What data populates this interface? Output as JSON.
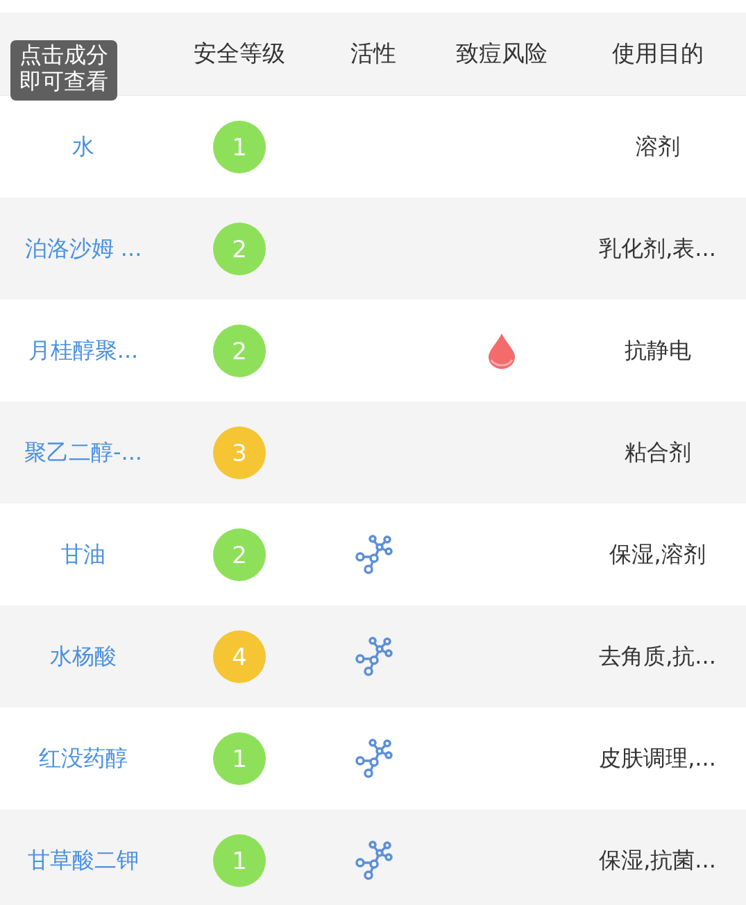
{
  "tooltip": "点击成分即可查看",
  "columns": [
    {
      "label": "安全等级"
    },
    {
      "label": "活性"
    },
    {
      "label": "致痘风险"
    },
    {
      "label": "使用目的"
    }
  ],
  "rows": [
    {
      "name": "水",
      "grade": "1",
      "color": "#8ee05b",
      "active": false,
      "acne_risk": false,
      "purpose": "溶剂"
    },
    {
      "name": "泊洛沙姆 ...",
      "grade": "2",
      "color": "#8ee05b",
      "active": false,
      "acne_risk": false,
      "purpose": "乳化剂,表..."
    },
    {
      "name": "月桂醇聚...",
      "grade": "2",
      "color": "#8ee05b",
      "active": false,
      "acne_risk": true,
      "purpose": "抗静电"
    },
    {
      "name": "聚乙二醇-...",
      "grade": "3",
      "color": "#f5c533",
      "active": false,
      "acne_risk": false,
      "purpose": "粘合剂"
    },
    {
      "name": "甘油",
      "grade": "2",
      "color": "#8ee05b",
      "active": true,
      "acne_risk": false,
      "purpose": "保湿,溶剂"
    },
    {
      "name": "水杨酸",
      "grade": "4",
      "color": "#f5c533",
      "active": true,
      "acne_risk": false,
      "purpose": "去角质,抗..."
    },
    {
      "name": "红没药醇",
      "grade": "1",
      "color": "#8ee05b",
      "active": true,
      "acne_risk": false,
      "purpose": "皮肤调理,..."
    },
    {
      "name": "甘草酸二钾",
      "grade": "1",
      "color": "#8ee05b",
      "active": true,
      "acne_risk": false,
      "purpose": "保湿,抗菌..."
    }
  ]
}
